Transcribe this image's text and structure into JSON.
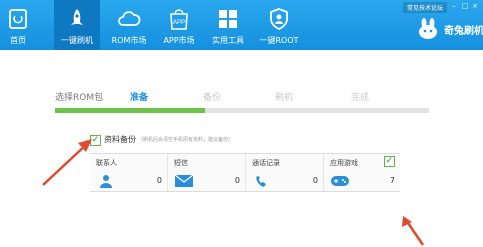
{
  "topbar": {
    "links": "常见技术论坛",
    "nav": [
      {
        "label": "首页",
        "icon": "home-icon"
      },
      {
        "label": "一键刷机",
        "icon": "rocket-icon"
      },
      {
        "label": "ROM市场",
        "icon": "cloud-icon"
      },
      {
        "label": "APP市场",
        "icon": "app-bag-icon",
        "icon_text": "APP"
      },
      {
        "label": "实用工具",
        "icon": "grid-icon"
      },
      {
        "label": "一键ROOT",
        "icon": "shield-icon"
      }
    ],
    "brand": "奇兔刷机"
  },
  "steps": {
    "items": [
      "选择ROM包",
      "准备",
      "备份",
      "刷机",
      "完成"
    ],
    "current_index": 1,
    "progress": 0.4
  },
  "backup": {
    "title": "资料备份",
    "note": "(刷机后会清空手机原有资料，建议备份)",
    "checked": true,
    "columns": [
      {
        "header": "联系人",
        "count": "0",
        "icon": "contact-icon"
      },
      {
        "header": "短信",
        "count": "0",
        "icon": "envelope-icon"
      },
      {
        "header": "通话记录",
        "count": "0",
        "icon": "phone-icon"
      },
      {
        "header": "应用游戏",
        "count": "7",
        "icon": "gamepad-icon",
        "checked": true
      }
    ]
  },
  "colors": {
    "topbar": "#1590de",
    "active_tab": "#0e78c2",
    "progress": "#6cc24a",
    "arrow": "#e24a2e"
  }
}
